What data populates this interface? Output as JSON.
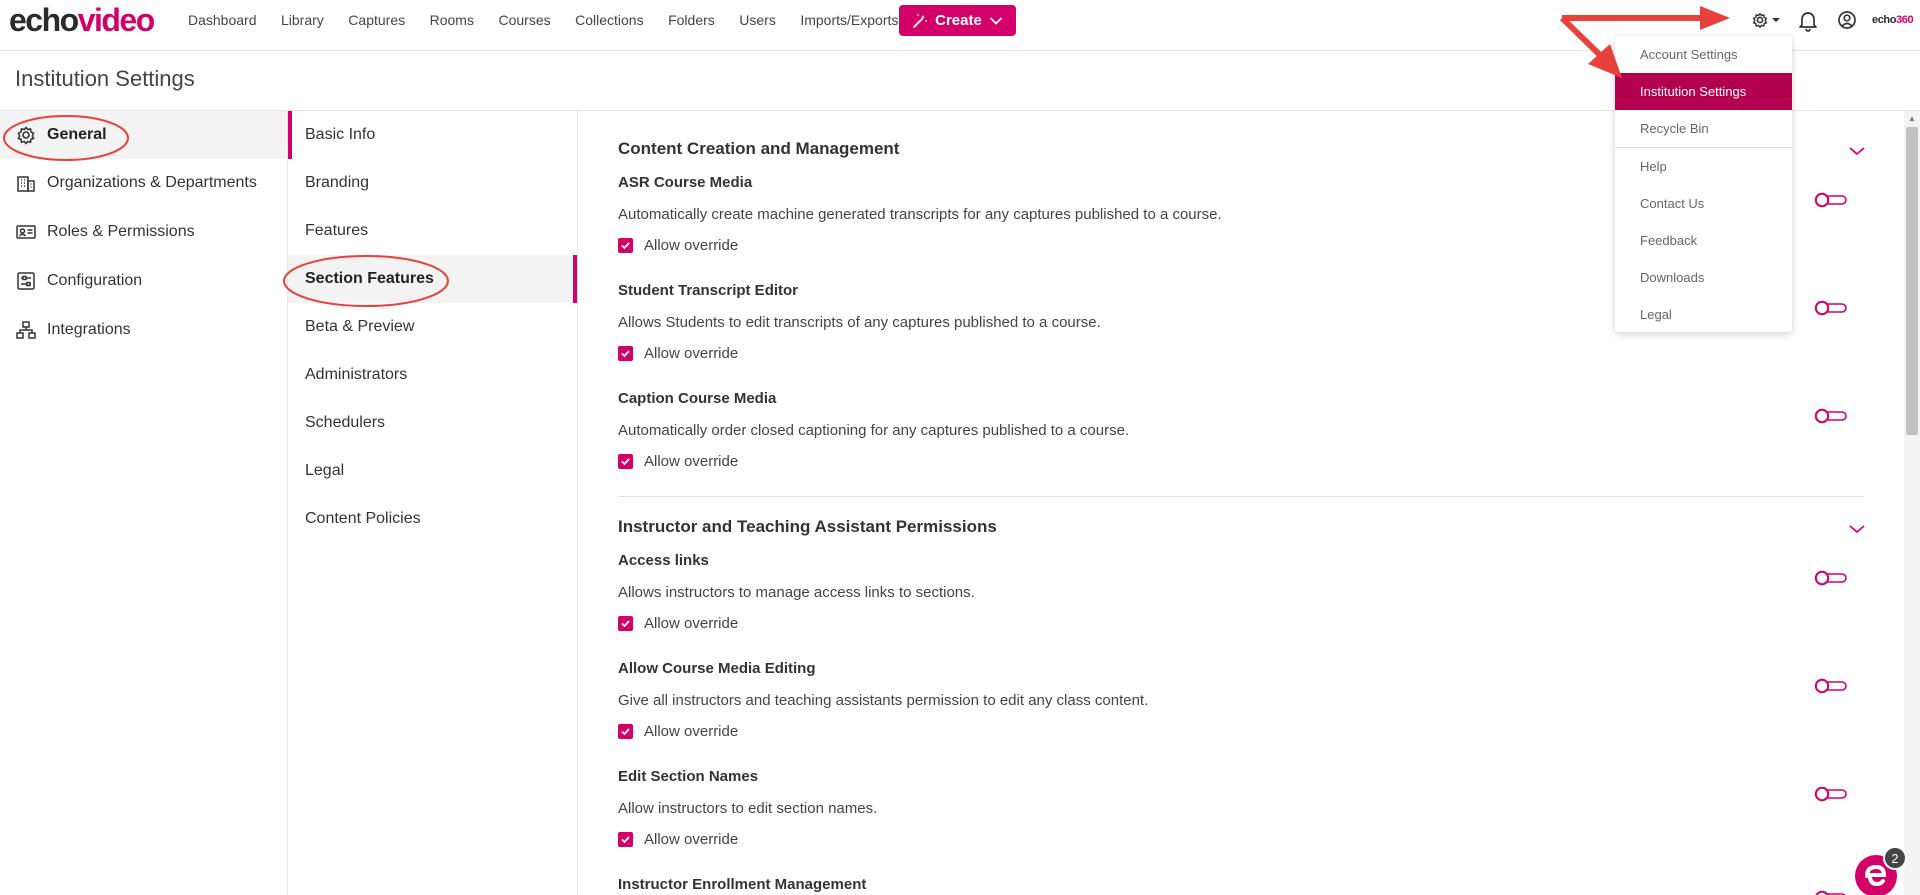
{
  "brand": {
    "part1": "echo",
    "part2": "video",
    "small_part1": "echo",
    "small_part2": "360"
  },
  "nav": [
    "Dashboard",
    "Library",
    "Captures",
    "Rooms",
    "Courses",
    "Collections",
    "Folders",
    "Users",
    "Imports/Exports"
  ],
  "create_label": "Create",
  "page_title": "Institution Settings",
  "sidebar": [
    {
      "label": "General",
      "icon": "gear-icon",
      "active": true
    },
    {
      "label": "Organizations & Departments",
      "icon": "building-icon",
      "active": false
    },
    {
      "label": "Roles & Permissions",
      "icon": "id-card-icon",
      "active": false
    },
    {
      "label": "Configuration",
      "icon": "sliders-icon",
      "active": false
    },
    {
      "label": "Integrations",
      "icon": "network-icon",
      "active": false
    }
  ],
  "subnav": [
    {
      "label": "Basic Info",
      "active": false
    },
    {
      "label": "Branding",
      "active": false
    },
    {
      "label": "Features",
      "active": false
    },
    {
      "label": "Section Features",
      "active": true
    },
    {
      "label": "Beta & Preview",
      "active": false
    },
    {
      "label": "Administrators",
      "active": false
    },
    {
      "label": "Schedulers",
      "active": false
    },
    {
      "label": "Legal",
      "active": false
    },
    {
      "label": "Content Policies",
      "active": false
    }
  ],
  "sections": [
    {
      "title": "Content Creation and Management",
      "settings": [
        {
          "title": "ASR Course Media",
          "desc": "Automatically create machine generated transcripts for any captures published to a course.",
          "check": "Allow override",
          "checked": true,
          "enabled": false
        },
        {
          "title": "Student Transcript Editor",
          "desc": "Allows Students to edit transcripts of any captures published to a course.",
          "check": "Allow override",
          "checked": true,
          "enabled": false
        },
        {
          "title": "Caption Course Media",
          "desc": "Automatically order closed captioning for any captures published to a course.",
          "check": "Allow override",
          "checked": true,
          "enabled": false
        }
      ]
    },
    {
      "title": "Instructor and Teaching Assistant Permissions",
      "settings": [
        {
          "title": "Access links",
          "desc": "Allows instructors to manage access links to sections.",
          "check": "Allow override",
          "checked": true,
          "enabled": false
        },
        {
          "title": "Allow Course Media Editing",
          "desc": "Give all instructors and teaching assistants permission to edit any class content.",
          "check": "Allow override",
          "checked": true,
          "enabled": false
        },
        {
          "title": "Edit Section Names",
          "desc": "Allow instructors to edit section names.",
          "check": "Allow override",
          "checked": true,
          "enabled": false
        },
        {
          "title": "Instructor Enrollment Management",
          "desc": "",
          "check": "",
          "checked": false,
          "enabled": false
        }
      ]
    }
  ],
  "dropdown": [
    {
      "label": "Account Settings",
      "active": false
    },
    {
      "label": "Institution Settings",
      "active": true
    },
    {
      "label": "Recycle Bin",
      "active": false
    },
    {
      "label": "Help",
      "active": false
    },
    {
      "label": "Contact Us",
      "active": false
    },
    {
      "label": "Feedback",
      "active": false
    },
    {
      "label": "Downloads",
      "active": false
    },
    {
      "label": "Legal",
      "active": false
    }
  ],
  "chat_badge": "2",
  "colors": {
    "accent": "#d4006a",
    "menu_active": "#b3004f",
    "annotation": "#e8403a"
  }
}
